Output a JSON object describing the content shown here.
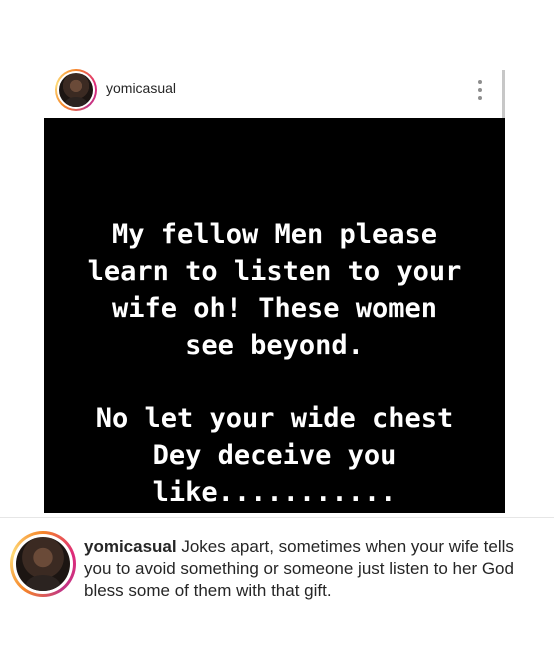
{
  "post": {
    "username": "yomicasual",
    "image_text": {
      "paragraph1": "My fellow Men please\nlearn to listen to your\nwife oh! These women\nsee beyond.",
      "paragraph2": "No let your wide chest\nDey deceive you\nlike..........."
    },
    "caption": {
      "username": "yomicasual",
      "text": " Jokes apart, sometimes when your wife tells you to avoid something or someone just listen to her God bless some of them with that gift."
    }
  },
  "icons": {
    "more": "more-vertical-icon",
    "avatar": "profile-avatar"
  },
  "colors": {
    "text": "#262626",
    "muted": "#8e8e8e",
    "image_bg": "#000000",
    "story_ring_start": "#f58529",
    "story_ring_end": "#dd2a7b"
  }
}
